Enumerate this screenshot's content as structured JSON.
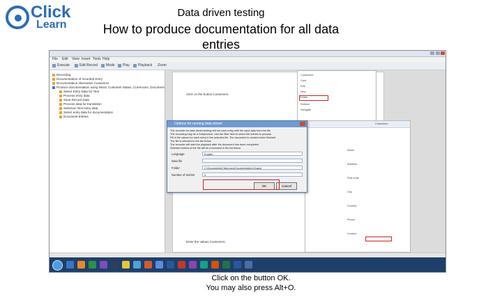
{
  "slide": {
    "logo_line1": "Click",
    "logo_line2": "Learn",
    "title": "Data driven testing",
    "subtitle": "How to produce documentation for all data entries",
    "caption_line1": "Click on the button OK.",
    "caption_line2": "You may also press Alt+O."
  },
  "app": {
    "menu": [
      "File",
      "Edit",
      "View",
      "Insert",
      "Tools",
      "Help"
    ],
    "toolbar_items": [
      "Execute",
      "Edit Record",
      "Mode",
      "Play",
      "Playback",
      "Zoom"
    ],
    "tree": [
      "Recording",
      "Documentation of recorded Entry",
      "Documentation Alternative Customers",
      "Produce documentation using Word: Customer Status, Currencies, Document Options",
      "Select Entry Data for Test",
      "Process entry data",
      "Save Record Data",
      "Process data for translation",
      "Selection Test entry data",
      "Select entry data for documentation",
      "Document Entries"
    ],
    "doc_text_1": "Click on the button Customers.",
    "doc_text_2": "Enter the values Customers."
  },
  "dialog": {
    "title": "Options for running data driven",
    "info_lines": [
      "The recorder for data driven testing will run each entry with the input data from the file",
      "The recording may be a Subprocess. Use the filter field to select the entries to process",
      "Fill in the values for each entry in the selected file. The document is created when finished",
      "The file is selected in the list below.",
      "The recorder will start the playback after the document has been completed",
      "Selected entries of the file will be processed in the list below."
    ],
    "label_language": "Language",
    "value_language": "English",
    "label_file": "Data file",
    "value_file": "",
    "label_folder": "Folder",
    "value_folder": "C:\\Documents\\ClickLearn\\Documentation\\Output",
    "label_count": "Number of entries",
    "value_count": "3",
    "ok_label": "OK",
    "cancel_label": "Cancel"
  },
  "erp": {
    "header": "Customers",
    "rows": [
      "Name",
      "Address",
      "Post code",
      "City",
      "Country",
      "Phone",
      "Contact"
    ],
    "values": [
      "",
      "",
      "",
      "",
      "",
      "",
      ""
    ]
  },
  "snapshot": {
    "rows": [
      "Customers",
      "Card",
      "Edit",
      "New",
      "Delete",
      "Refresh",
      "Navigate"
    ]
  }
}
